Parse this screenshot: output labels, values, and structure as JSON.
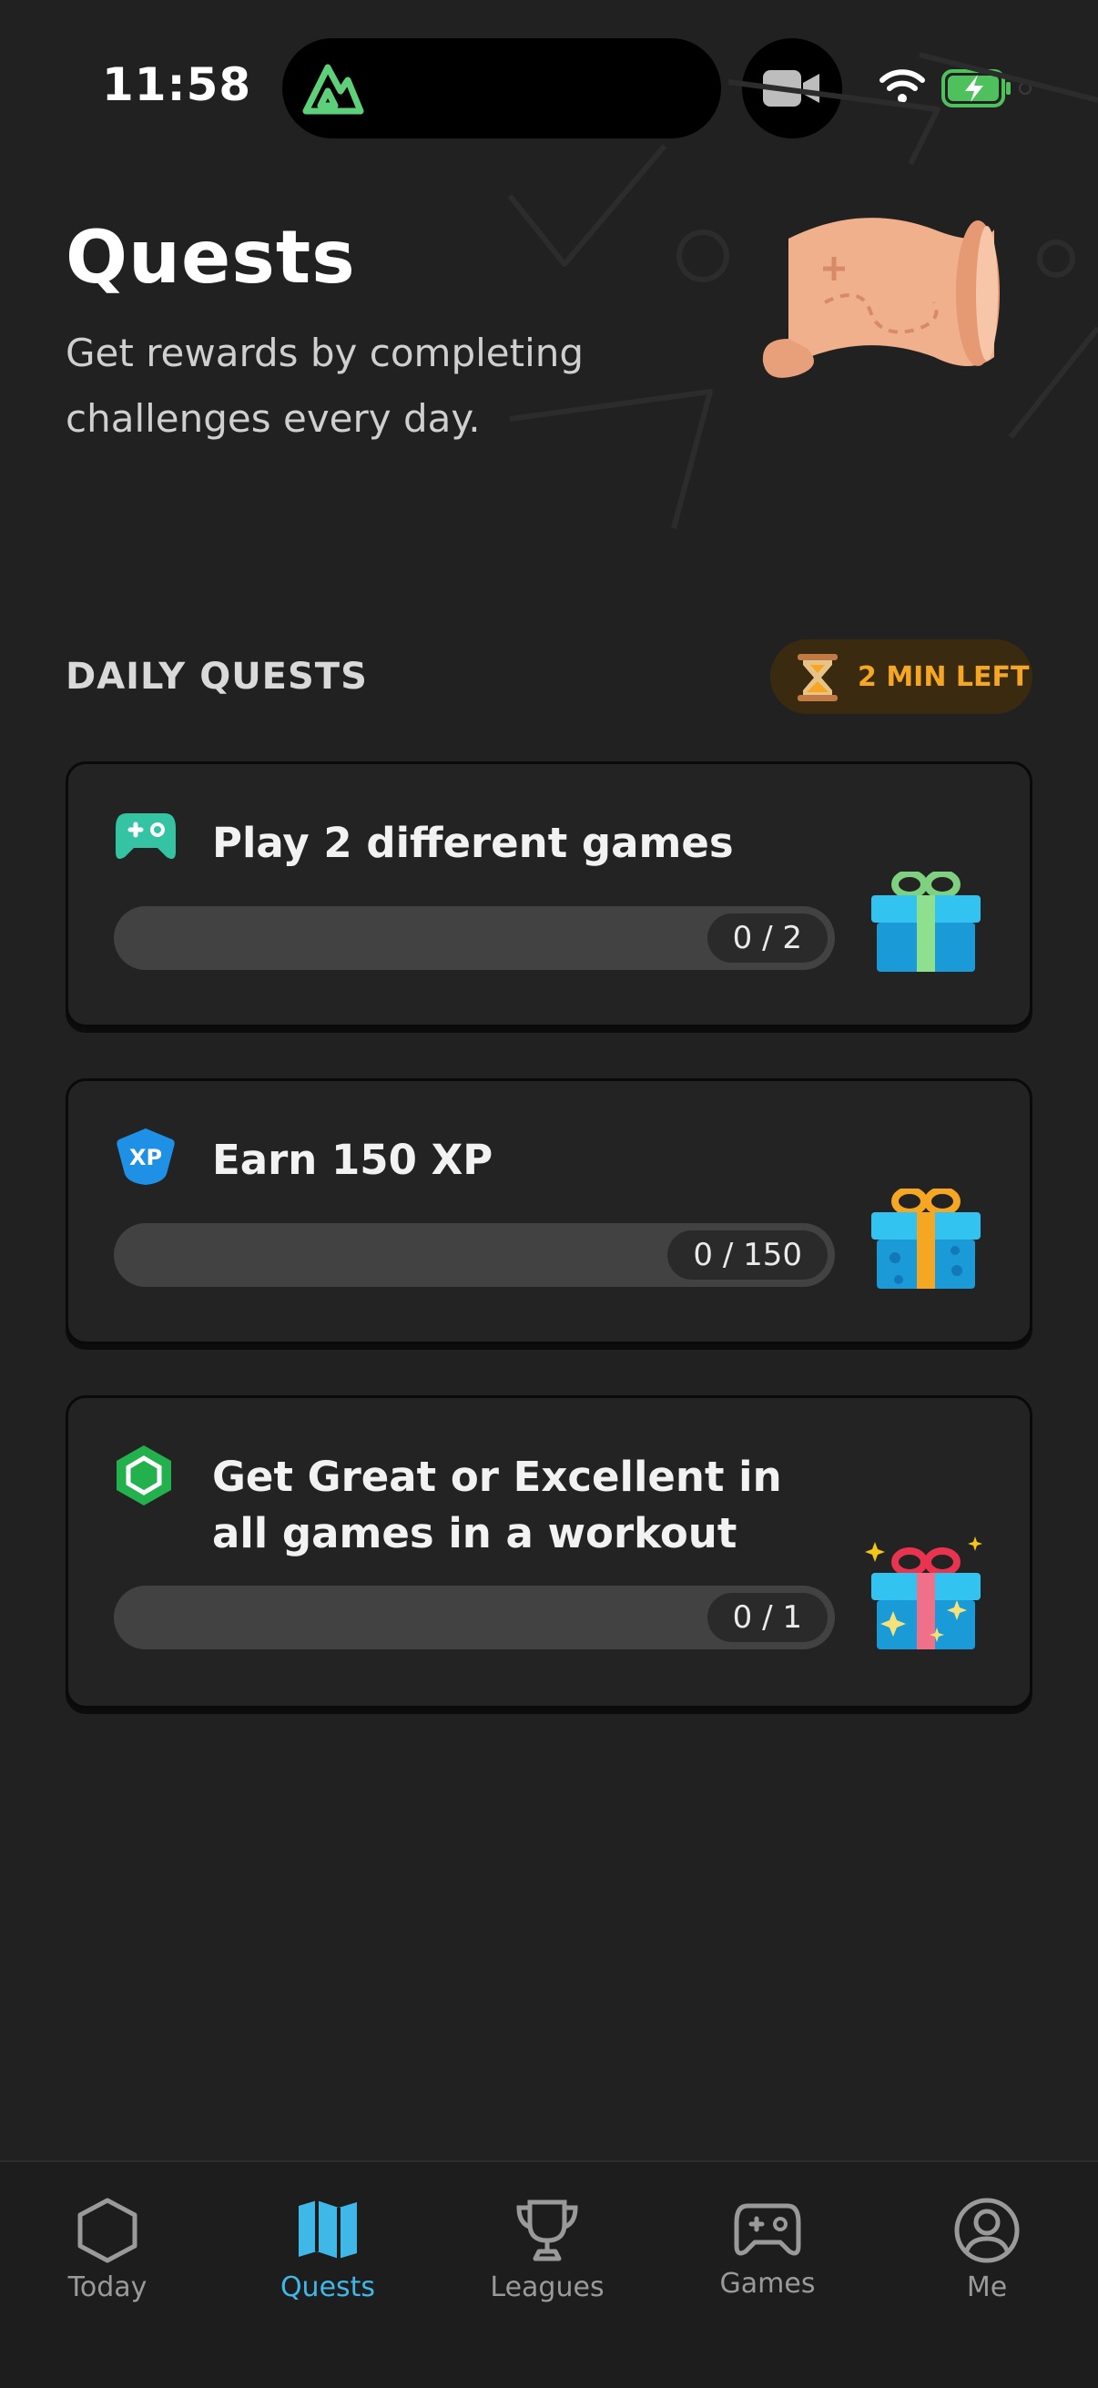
{
  "status_bar": {
    "time": "11:58"
  },
  "header": {
    "title": "Quests",
    "subtitle": "Get rewards by completing challenges every day."
  },
  "daily_quests": {
    "label": "DAILY QUESTS",
    "timer": "2 MIN LEFT",
    "quests": [
      {
        "title": "Play 2 different games",
        "progress_text": "0 / 2",
        "current": 0,
        "target": 2,
        "icon": "gamepad-icon",
        "reward": "gift-green-icon"
      },
      {
        "title": "Earn 150 XP",
        "progress_text": "0 / 150",
        "current": 0,
        "target": 150,
        "icon": "xp-badge-icon",
        "reward": "gift-blue-icon"
      },
      {
        "title": "Get Great or Excellent in all games in a workout",
        "progress_text": "0 / 1",
        "current": 0,
        "target": 1,
        "icon": "hexagon-icon",
        "reward": "gift-sparkle-icon"
      }
    ]
  },
  "tab_bar": {
    "active": "Quests",
    "tabs": [
      {
        "label": "Today",
        "icon": "hexagon-outline-icon"
      },
      {
        "label": "Quests",
        "icon": "map-icon"
      },
      {
        "label": "Leagues",
        "icon": "trophy-icon"
      },
      {
        "label": "Games",
        "icon": "gamepad-icon"
      },
      {
        "label": "Me",
        "icon": "profile-icon"
      }
    ]
  },
  "colors": {
    "background": "#212121",
    "accent": "#3fb8e8",
    "timer": "#f5a623",
    "progress_track": "#424242"
  }
}
